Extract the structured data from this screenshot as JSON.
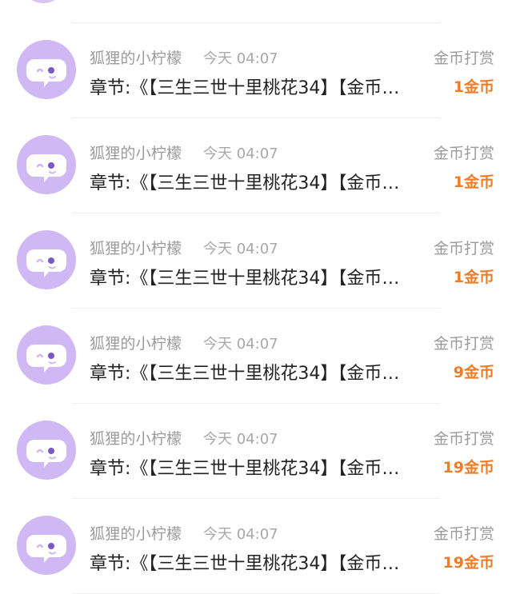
{
  "items": [
    {
      "name": "狐狸的小柠檬",
      "time": "今天 04:07",
      "type": "金币打赏",
      "chapter": "章节:《【三生三世十里桃花34】【金币…",
      "amount": "1金币"
    },
    {
      "name": "狐狸的小柠檬",
      "time": "今天 04:07",
      "type": "金币打赏",
      "chapter": "章节:《【三生三世十里桃花34】【金币…",
      "amount": "1金币"
    },
    {
      "name": "狐狸的小柠檬",
      "time": "今天 04:07",
      "type": "金币打赏",
      "chapter": "章节:《【三生三世十里桃花34】【金币…",
      "amount": "1金币"
    },
    {
      "name": "狐狸的小柠檬",
      "time": "今天 04:07",
      "type": "金币打赏",
      "chapter": "章节:《【三生三世十里桃花34】【金币…",
      "amount": "9金币"
    },
    {
      "name": "狐狸的小柠檬",
      "time": "今天 04:07",
      "type": "金币打赏",
      "chapter": "章节:《【三生三世十里桃花34】【金币…",
      "amount": "19金币"
    },
    {
      "name": "狐狸的小柠檬",
      "time": "今天 04:07",
      "type": "金币打赏",
      "chapter": "章节:《【三生三世十里桃花34】【金币…",
      "amount": "19金币"
    }
  ],
  "colors": {
    "avatar_bg": "#cfb8f3",
    "amount": "#ef7d28",
    "secondary_text": "#9b9b9b",
    "primary_text": "#222222"
  },
  "icons": {
    "avatar": "chat-bubble-face-icon"
  }
}
